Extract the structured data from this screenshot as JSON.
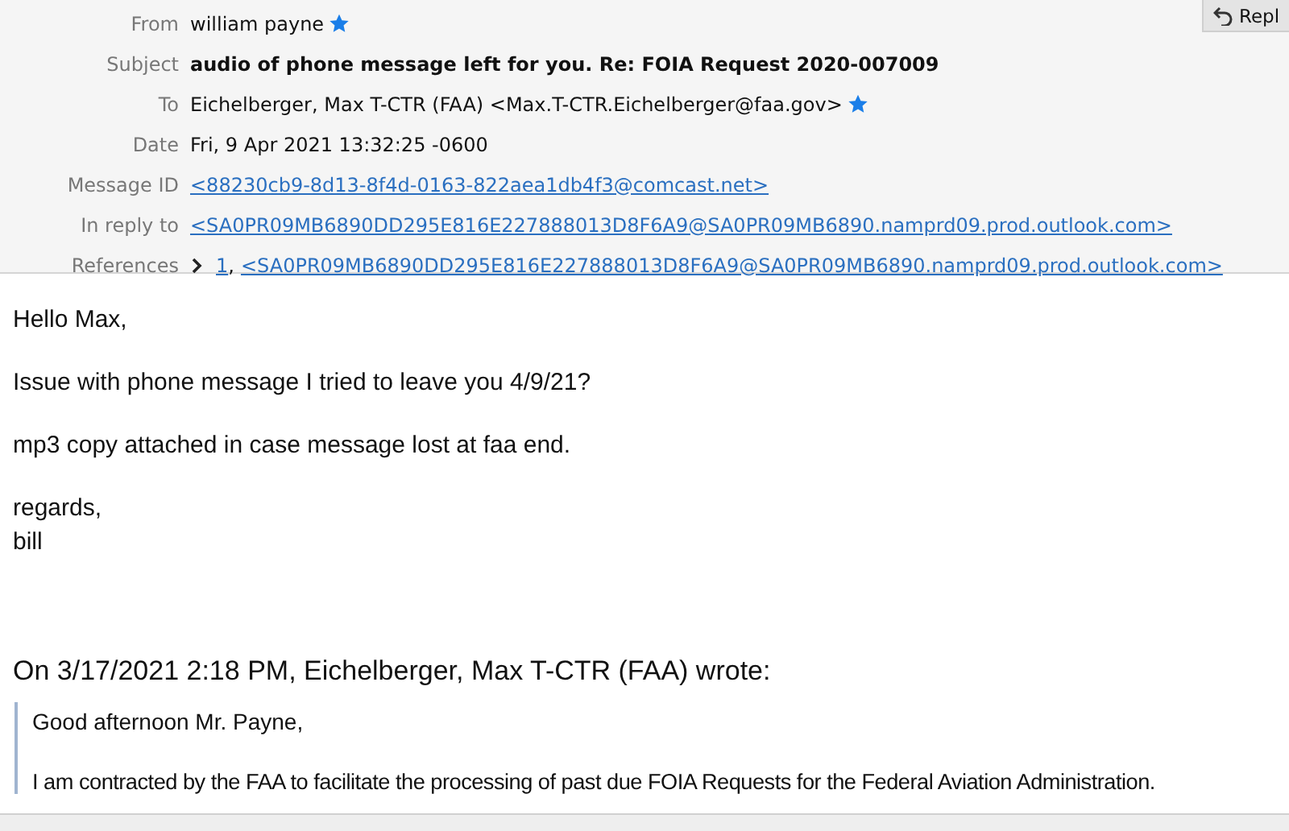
{
  "toolbar": {
    "reply_button": "Repl"
  },
  "header": [
    {
      "kind": "text",
      "label": "From",
      "value": "william payne",
      "starred": true
    },
    {
      "kind": "subject",
      "label": "Subject",
      "value": "audio of phone message left for you. Re: FOIA Request 2020-007009"
    },
    {
      "kind": "text",
      "label": "To",
      "value": "Eichelberger, Max T-CTR (FAA) <Max.T-CTR.Eichelberger@faa.gov>",
      "starred": true
    },
    {
      "kind": "text",
      "label": "Date",
      "value": "Fri, 9 Apr 2021 13:32:25 -0600"
    },
    {
      "kind": "link",
      "label": "Message ID",
      "value": "<88230cb9-8d13-8f4d-0163-822aea1db4f3@comcast.net>"
    },
    {
      "kind": "link",
      "label": "In reply to",
      "value": "<SA0PR09MB6890DD295E816E227888013D8F6A9@SA0PR09MB6890.namprd09.prod.outlook.com>"
    },
    {
      "kind": "references",
      "label": "References",
      "count": "1",
      "separator": ",",
      "value": "<SA0PR09MB6890DD295E816E227888013D8F6A9@SA0PR09MB6890.namprd09.prod.outlook.com>"
    }
  ],
  "body": {
    "paragraphs": [
      [
        "Hello Max,"
      ],
      [
        "Issue with phone message I tried to leave you 4/9/21?"
      ],
      [
        "mp3 copy attached in case message lost at faa end."
      ],
      [
        "regards,",
        "bill"
      ]
    ],
    "quote_intro": "On 3/17/2021 2:18 PM, Eichelberger, Max T-CTR (FAA) wrote:",
    "quote": [
      "Good afternoon Mr. Payne,",
      "I am contracted by the FAA to facilitate the processing of past due FOIA Requests for the Federal Aviation Administration."
    ]
  }
}
